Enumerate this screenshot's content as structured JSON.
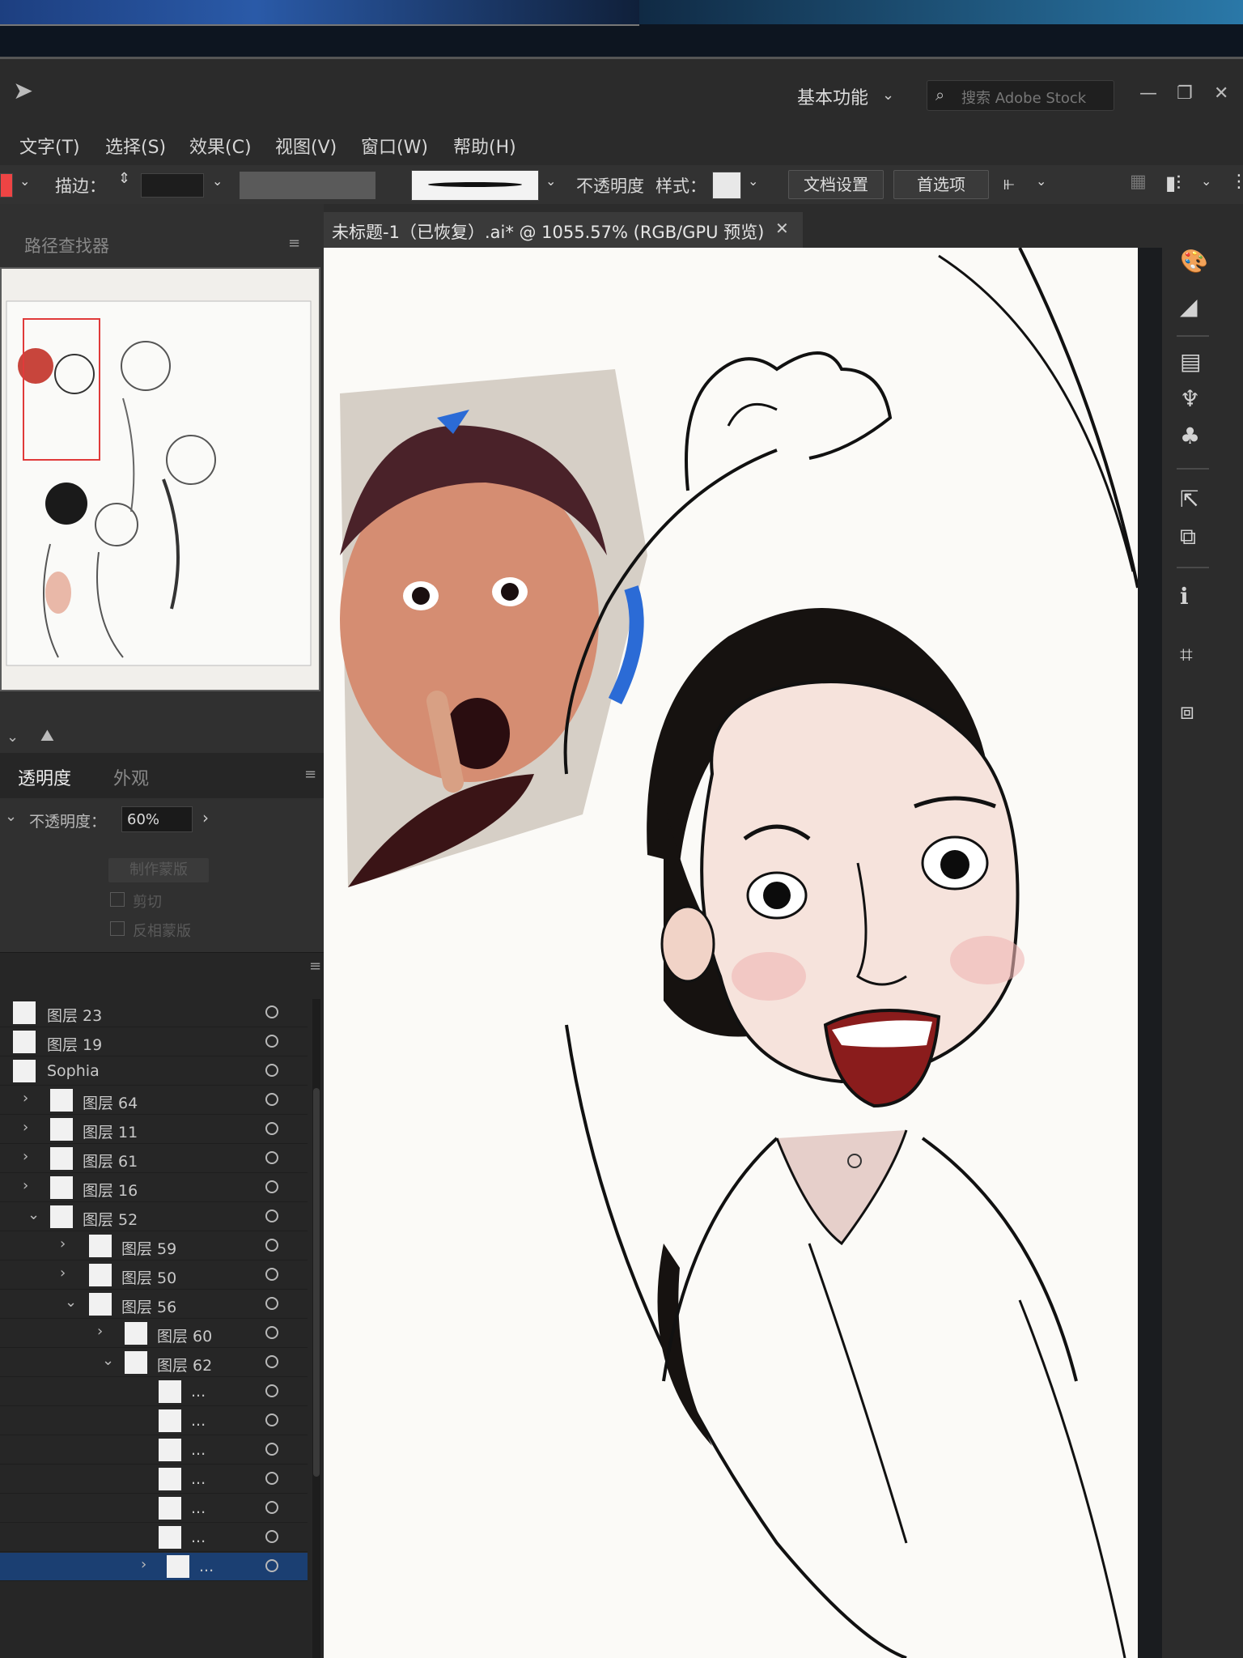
{
  "titlebar": {
    "workspace_label": "基本功能",
    "search_placeholder": "搜索 Adobe Stock"
  },
  "menu": {
    "items": [
      {
        "label": "文字(T)"
      },
      {
        "label": "选择(S)"
      },
      {
        "label": "效果(C)"
      },
      {
        "label": "视图(V)"
      },
      {
        "label": "窗口(W)"
      },
      {
        "label": "帮助(H)"
      }
    ]
  },
  "control_bar": {
    "stroke_label": "描边：",
    "opacity_label": "不透明度",
    "style_label": "样式：",
    "doc_setup_button": "文档设置",
    "preferences_button": "首选项"
  },
  "left_panel": {
    "pathfinder_tab": "路径查找器"
  },
  "transparency": {
    "tab_active": "透明度",
    "tab_appearance": "外观",
    "opacity_label": "不透明度：",
    "opacity_value": "60%",
    "make_mask_button": "制作蒙版",
    "clip_label": "剪切",
    "invert_mask_label": "反相蒙版"
  },
  "document": {
    "tab_title": "未标题-1（已恢复）.ai* @ 1055.57% (RGB/GPU 预览)"
  },
  "layers": [
    {
      "name": "图层 23"
    },
    {
      "name": "图层 19"
    },
    {
      "name": "Sophia"
    },
    {
      "name": "图层 64"
    },
    {
      "name": "图层 11"
    },
    {
      "name": "图层 61"
    },
    {
      "name": "图层 16"
    },
    {
      "name": "图层 52"
    },
    {
      "name": "图层 59"
    },
    {
      "name": "图层 50"
    },
    {
      "name": "图层 56"
    },
    {
      "name": "图层 60"
    },
    {
      "name": "图层 62"
    },
    {
      "name": "..."
    },
    {
      "name": "..."
    },
    {
      "name": "..."
    },
    {
      "name": "..."
    },
    {
      "name": "..."
    },
    {
      "name": "..."
    },
    {
      "name": "..."
    }
  ],
  "colors": {
    "selected_layer": "#1b3f72",
    "canvas_bg": "#fbfaf7",
    "ui_dark": "#2b2b2b"
  }
}
